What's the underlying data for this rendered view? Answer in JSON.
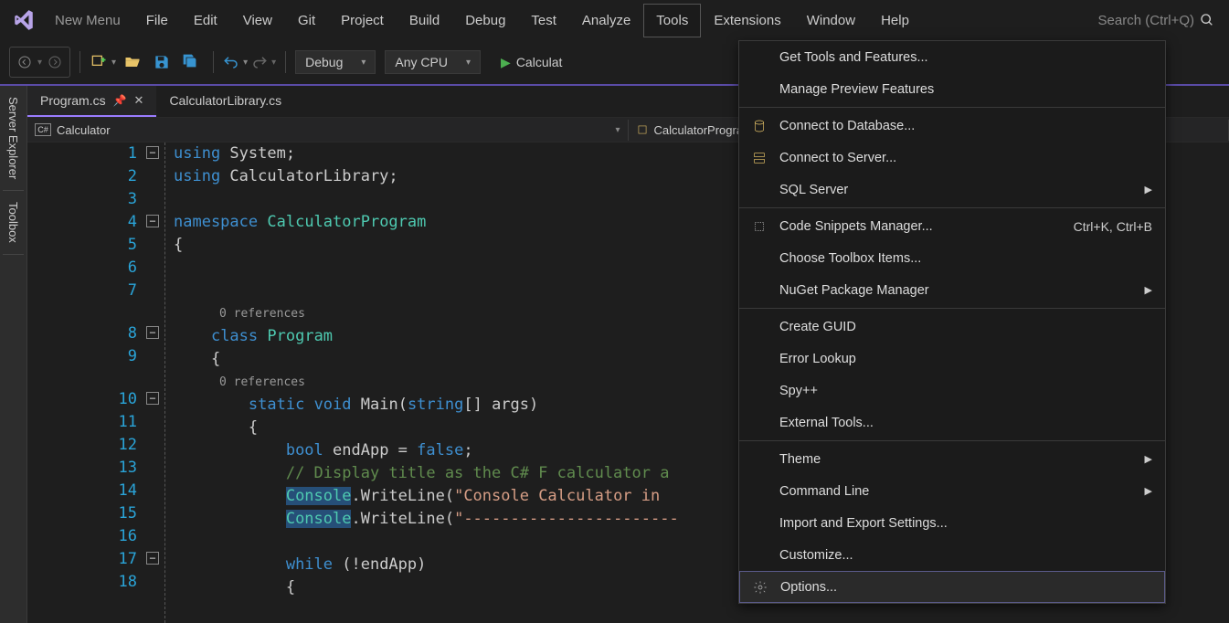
{
  "menubar": {
    "new_menu": "New Menu",
    "items": [
      "File",
      "Edit",
      "View",
      "Git",
      "Project",
      "Build",
      "Debug",
      "Test",
      "Analyze",
      "Tools",
      "Extensions",
      "Window",
      "Help"
    ],
    "active_index": 9,
    "search_placeholder": "Search (Ctrl+Q)"
  },
  "toolbar": {
    "config": "Debug",
    "platform": "Any CPU",
    "run_label": "Calculat"
  },
  "side_tabs": [
    "Server Explorer",
    "Toolbox"
  ],
  "tabs": [
    {
      "label": "Program.cs",
      "active": true,
      "pinned": true
    },
    {
      "label": "CalculatorLibrary.cs",
      "active": false,
      "pinned": false
    }
  ],
  "nav": {
    "left": "Calculator",
    "right": "CalculatorProgram.Program"
  },
  "code": {
    "lines": [
      {
        "n": 1,
        "fold": true,
        "t": [
          {
            "c": "kw",
            "v": "using"
          },
          {
            "c": "",
            "v": " System;"
          }
        ]
      },
      {
        "n": 2,
        "t": [
          {
            "c": "kw",
            "v": "using"
          },
          {
            "c": "",
            "v": " CalculatorLibrary;"
          }
        ]
      },
      {
        "n": 3,
        "t": []
      },
      {
        "n": 4,
        "fold": true,
        "t": [
          {
            "c": "kw",
            "v": "namespace"
          },
          {
            "c": "",
            "v": " "
          },
          {
            "c": "cls",
            "v": "CalculatorProgram"
          }
        ]
      },
      {
        "n": 5,
        "t": [
          {
            "c": "",
            "v": "{"
          }
        ]
      },
      {
        "n": 6,
        "t": []
      },
      {
        "n": 7,
        "t": []
      },
      {
        "ref": "0 references"
      },
      {
        "n": 8,
        "fold": true,
        "t": [
          {
            "c": "",
            "v": "    "
          },
          {
            "c": "kw",
            "v": "class"
          },
          {
            "c": "",
            "v": " "
          },
          {
            "c": "cls",
            "v": "Program"
          }
        ]
      },
      {
        "n": 9,
        "t": [
          {
            "c": "",
            "v": "    {"
          }
        ]
      },
      {
        "ref": "0 references"
      },
      {
        "n": 10,
        "fold": true,
        "t": [
          {
            "c": "",
            "v": "        "
          },
          {
            "c": "kw",
            "v": "static"
          },
          {
            "c": "",
            "v": " "
          },
          {
            "c": "kw",
            "v": "void"
          },
          {
            "c": "",
            "v": " Main("
          },
          {
            "c": "kw",
            "v": "string"
          },
          {
            "c": "",
            "v": "[] args)"
          }
        ]
      },
      {
        "n": 11,
        "t": [
          {
            "c": "",
            "v": "        {"
          }
        ]
      },
      {
        "n": 12,
        "t": [
          {
            "c": "",
            "v": "            "
          },
          {
            "c": "kw",
            "v": "bool"
          },
          {
            "c": "",
            "v": " endApp = "
          },
          {
            "c": "kw",
            "v": "false"
          },
          {
            "c": "",
            "v": ";"
          }
        ]
      },
      {
        "n": 13,
        "t": [
          {
            "c": "",
            "v": "            "
          },
          {
            "c": "com",
            "v": "// Display title as the C# F calculator a"
          }
        ]
      },
      {
        "n": 14,
        "t": [
          {
            "c": "",
            "v": "            "
          },
          {
            "c": "cls hl",
            "v": "Console"
          },
          {
            "c": "",
            "v": ".WriteLine("
          },
          {
            "c": "str",
            "v": "\"Console Calculator in "
          }
        ]
      },
      {
        "n": 15,
        "t": [
          {
            "c": "",
            "v": "            "
          },
          {
            "c": "cls hl",
            "v": "Console"
          },
          {
            "c": "",
            "v": ".WriteLine("
          },
          {
            "c": "str",
            "v": "\"-----------------------"
          }
        ]
      },
      {
        "n": 16,
        "t": []
      },
      {
        "n": 17,
        "fold": true,
        "t": [
          {
            "c": "",
            "v": "            "
          },
          {
            "c": "kw",
            "v": "while"
          },
          {
            "c": "",
            "v": " (!endApp)"
          }
        ]
      },
      {
        "n": 18,
        "t": [
          {
            "c": "",
            "v": "            {"
          }
        ]
      }
    ]
  },
  "dropdown": {
    "items": [
      {
        "label": "Get Tools and Features..."
      },
      {
        "label": "Manage Preview Features"
      },
      {
        "sep": true
      },
      {
        "label": "Connect to Database...",
        "icon": "database"
      },
      {
        "label": "Connect to Server...",
        "icon": "server"
      },
      {
        "label": "SQL Server",
        "sub": true
      },
      {
        "sep": true
      },
      {
        "label": "Code Snippets Manager...",
        "shortcut": "Ctrl+K, Ctrl+B",
        "icon": "snippet"
      },
      {
        "label": "Choose Toolbox Items..."
      },
      {
        "label": "NuGet Package Manager",
        "sub": true
      },
      {
        "sep": true
      },
      {
        "label": "Create GUID"
      },
      {
        "label": "Error Lookup"
      },
      {
        "label": "Spy++"
      },
      {
        "label": "External Tools..."
      },
      {
        "sep": true
      },
      {
        "label": "Theme",
        "sub": true
      },
      {
        "label": "Command Line",
        "sub": true
      },
      {
        "label": "Import and Export Settings..."
      },
      {
        "label": "Customize..."
      },
      {
        "label": "Options...",
        "icon": "gear",
        "selected": true
      }
    ]
  }
}
